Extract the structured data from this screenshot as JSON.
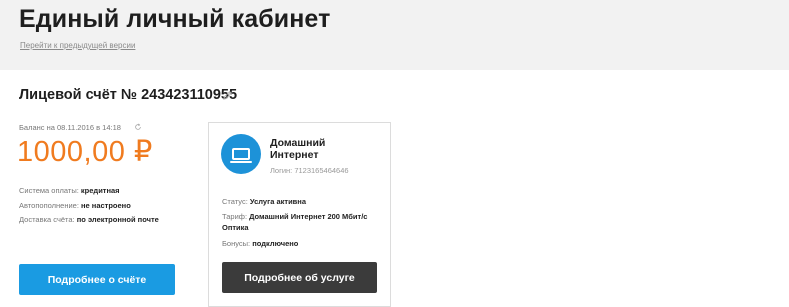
{
  "header": {
    "title": "Единый личный кабинет",
    "prev_version_link": "Перейти к предыдущей версии"
  },
  "account": {
    "title": "Лицевой счёт № 243423110955",
    "balance_label": "Баланс на 08.11.2016 в 14:18",
    "balance_value": "1000,00 ₽",
    "payment_system_label": "Система оплаты:",
    "payment_system_value": "кредитная",
    "autopay_label": "Автопополнение:",
    "autopay_value": "не настроено",
    "delivery_label": "Доставка счёта:",
    "delivery_value": "по электронной почте",
    "details_button": "Подробнее о счёте"
  },
  "service": {
    "name": "Домашний Интернет",
    "login": "Логин: 7123165464646",
    "status_label": "Статус:",
    "status_value": "Услуга активна",
    "tariff_label": "Тариф:",
    "tariff_value": "Домашний Интернет 200 Мбит/с Оптика",
    "bonus_label": "Бонусы:",
    "bonus_value": "подключено",
    "details_button": "Подробнее об услуге",
    "icon": "laptop-icon"
  },
  "icons": {
    "edit": "pencil-icon",
    "refresh": "refresh-icon"
  },
  "colors": {
    "balance": "#f07b1f",
    "primary_button": "#1a9be2",
    "dark_button": "#3b3b3b",
    "service_icon": "#1d92d8"
  }
}
